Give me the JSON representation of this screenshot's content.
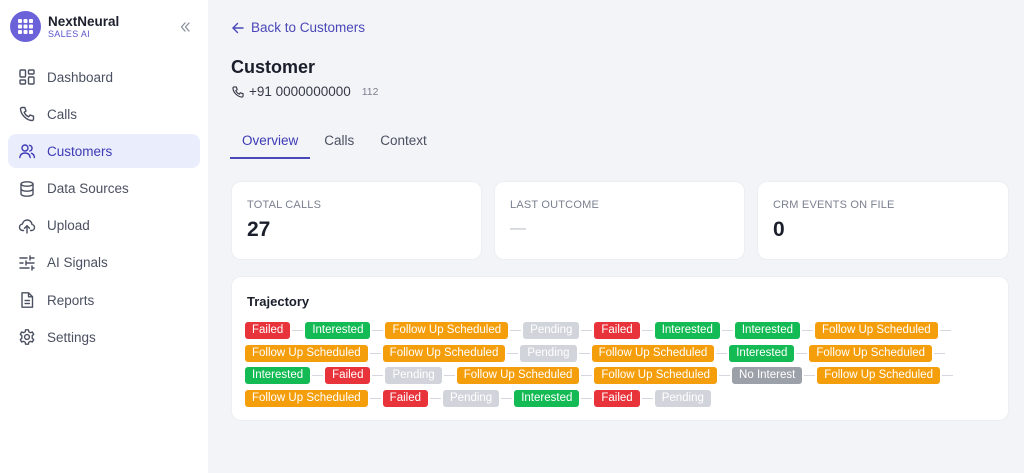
{
  "brand": {
    "name": "NextNeural",
    "sub": "SALES AI",
    "logo_icon": "grid-icon"
  },
  "sidebar": {
    "items": [
      {
        "label": "Dashboard",
        "icon": "dashboard-icon",
        "active": false
      },
      {
        "label": "Calls",
        "icon": "phone-icon",
        "active": false
      },
      {
        "label": "Customers",
        "icon": "users-icon",
        "active": true
      },
      {
        "label": "Data Sources",
        "icon": "database-icon",
        "active": false
      },
      {
        "label": "Upload",
        "icon": "upload-cloud-icon",
        "active": false
      },
      {
        "label": "AI Signals",
        "icon": "sliders-icon",
        "active": false
      },
      {
        "label": "Reports",
        "icon": "file-text-icon",
        "active": false
      },
      {
        "label": "Settings",
        "icon": "gear-icon",
        "active": false
      }
    ]
  },
  "header": {
    "back_label": "Back to Customers",
    "title": "Customer",
    "phone": "+91 0000000000",
    "id": "112"
  },
  "tabs": [
    {
      "label": "Overview",
      "active": true
    },
    {
      "label": "Calls",
      "active": false
    },
    {
      "label": "Context",
      "active": false
    }
  ],
  "stats": [
    {
      "label": "TOTAL CALLS",
      "value": "27"
    },
    {
      "label": "LAST OUTCOME",
      "value": "—"
    },
    {
      "label": "CRM EVENTS ON FILE",
      "value": "0"
    }
  ],
  "trajectory": {
    "title": "Trajectory",
    "rows": [
      [
        "Failed",
        "Interested",
        "Follow Up Scheduled",
        "Pending",
        "Failed",
        "Interested",
        "Interested",
        "Follow Up Scheduled"
      ],
      [
        "Follow Up Scheduled",
        "Follow Up Scheduled",
        "Pending",
        "Follow Up Scheduled",
        "Interested",
        "Follow Up Scheduled"
      ],
      [
        "Interested",
        "Failed",
        "Pending",
        "Follow Up Scheduled",
        "Follow Up Scheduled",
        "No Interest",
        "Follow Up Scheduled"
      ],
      [
        "Follow Up Scheduled",
        "Failed",
        "Pending",
        "Interested",
        "Failed",
        "Pending"
      ]
    ]
  },
  "colors": {
    "accent": "#4a47b8",
    "failed": "#e8333b",
    "interested": "#14ba54",
    "follow_up": "#f59e0b",
    "pending": "#d1d4da",
    "no_interest": "#9ca0a9"
  }
}
